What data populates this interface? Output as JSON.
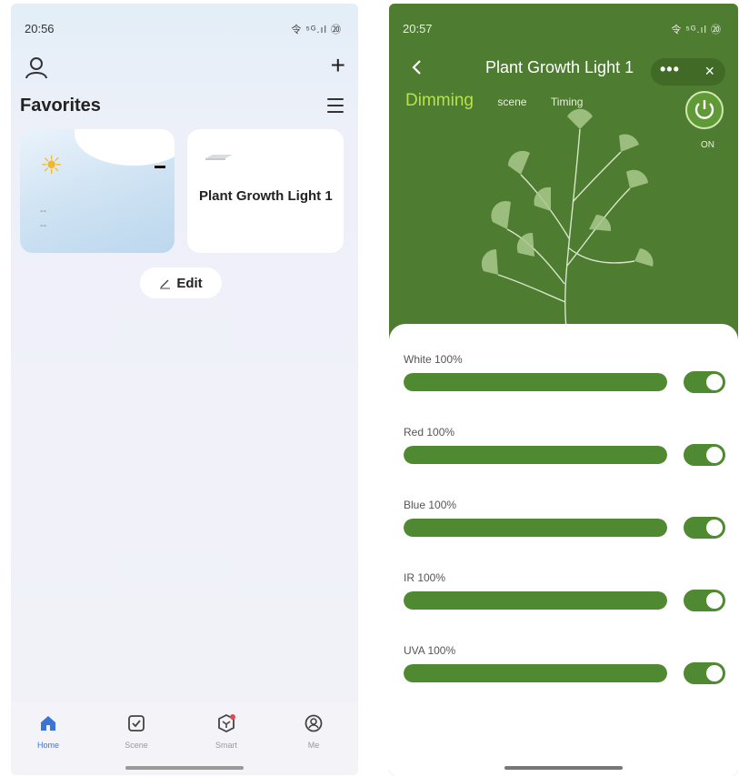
{
  "left_screen": {
    "status": {
      "time": "20:56",
      "icons": "令 ⁵ᴳ.ıl ⑳"
    },
    "favorites_title": "Favorites",
    "weather": {
      "line1": "--",
      "line2": "--"
    },
    "device": {
      "name": "Plant Growth Light 1"
    },
    "edit_label": "Edit",
    "tabs": [
      {
        "label": "Home",
        "icon": "home-icon",
        "active": true
      },
      {
        "label": "Scene",
        "icon": "scene-check-icon",
        "active": false
      },
      {
        "label": "Smart",
        "icon": "smart-icon",
        "active": false
      },
      {
        "label": "Me",
        "icon": "user-circle-icon",
        "active": false
      }
    ]
  },
  "right_screen": {
    "status": {
      "time": "20:57",
      "icons": "令 ⁵ᴳ.ıl ⑳"
    },
    "title": "Plant Growth Light 1",
    "more": "•••",
    "close": "×",
    "tabs": {
      "dimming": "Dimming",
      "scene": "scene",
      "timing": "Timing"
    },
    "power_label": "ON",
    "channels": [
      {
        "label": "White 100%",
        "level": 100,
        "on": true
      },
      {
        "label": "Red 100%",
        "level": 100,
        "on": true
      },
      {
        "label": "Blue 100%",
        "level": 100,
        "on": true
      },
      {
        "label": "IR 100%",
        "level": 100,
        "on": true
      },
      {
        "label": "UVA 100%",
        "level": 100,
        "on": true
      }
    ]
  },
  "colors": {
    "accent_green": "#4f8a33",
    "dimming_text": "#b8e24a",
    "home_tab_blue": "#3b74d4"
  }
}
